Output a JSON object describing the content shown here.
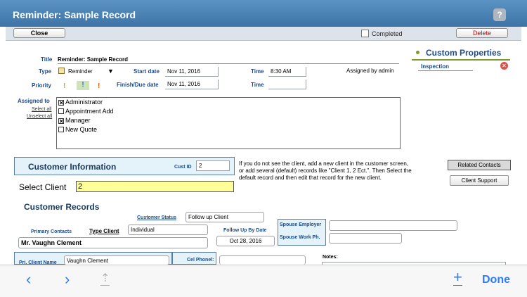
{
  "window": {
    "title": "Reminder: Sample Record",
    "help_icon": "?"
  },
  "toolbar": {
    "close_label": "Close",
    "completed_label": "Completed",
    "delete_label": "Delete"
  },
  "form": {
    "title_label": "Title",
    "title_value": "Reminder: Sample Record",
    "type_label": "Type",
    "type_value": "Reminder",
    "start_date_label": "Start date",
    "start_date_value": "Nov 11, 2016",
    "time_label": "Time",
    "time_value": "8:30 AM",
    "assigned_by": "Assigned by admin",
    "priority_label": "Priority",
    "finish_label": "Finish/Due date",
    "finish_value": "Nov 11, 2016",
    "time2_label": "Time",
    "time2_value": ""
  },
  "custom_properties": {
    "title": "Custom Properties",
    "inspection_label": "Inspection"
  },
  "assigned": {
    "label": "Assigned to",
    "select_all": "Select all",
    "unselect_all": "Unselect all",
    "items": [
      {
        "label": "Administrator",
        "checked": true
      },
      {
        "label": "Appointment Add",
        "checked": false
      },
      {
        "label": "Manager",
        "checked": true
      },
      {
        "label": "New Quote",
        "checked": false
      }
    ]
  },
  "customer_info": {
    "title": "Customer Information",
    "cust_id_label": "Cust ID",
    "cust_id_value": "2",
    "info_text": "If you do not see the client, add a new client in the customer screen, or add several (default) records like \"Client 1, 2 Ect.\". Then Select the default record and then edit that record for the new client.",
    "related_contacts": "Related Contacts",
    "client_support": "Client Support",
    "select_client_label": "Select Client",
    "select_client_value": "2"
  },
  "customer_records": {
    "title": "Customer Records",
    "customer_status_label": "Customer Status",
    "customer_status_value": "Follow up Client",
    "type_client_label": "Type Client",
    "type_client_value": "Individual",
    "primary_contacts_label": "Primary Contacts",
    "primary_contact_value": "Mr. Vaughn Clement",
    "follow_up_label": "Follow Up By Date",
    "follow_up_value": "Oct 28, 2016",
    "spouse_employer_label": "Spouse Employer",
    "spouse_work_label": "Spouse Work Ph.",
    "pri_client_name_label": "Pri. Client Name",
    "pri_client_name_value": "Vaughn Clement",
    "cel_phone_label": "Cel Phonel:",
    "notes_label": "Notes:"
  },
  "bottombar": {
    "back_icon": "‹",
    "forward_icon": "›",
    "share_icon": "⇡",
    "add_icon": "+",
    "done_label": "Done"
  }
}
